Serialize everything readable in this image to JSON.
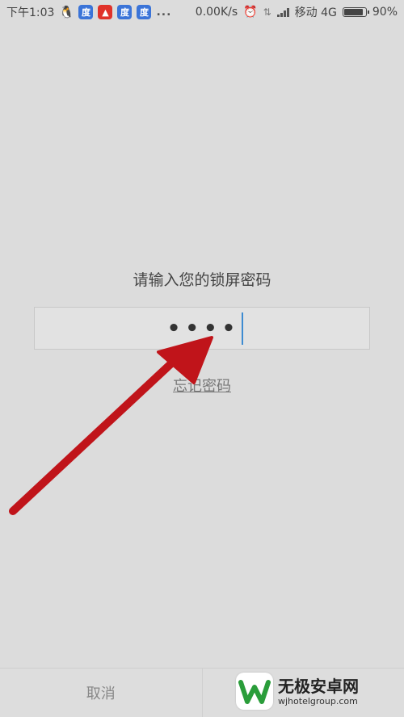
{
  "status_bar": {
    "time": "下午1:03",
    "network_speed": "0.00K/s",
    "carrier": "移动 4G",
    "battery_percent": "90%",
    "battery_level": 0.9,
    "more_indicator": "...",
    "icons": [
      "qq-icon",
      "baidu-icon",
      "red-app-icon",
      "baidu-icon",
      "baidu-icon",
      "alarm-icon",
      "data-arrows-icon",
      "signal-icon",
      "battery-icon"
    ]
  },
  "lock": {
    "prompt": "请输入您的锁屏密码",
    "password_mask": "••••",
    "forgot_link": "忘记密码"
  },
  "bottom": {
    "cancel_label": "取消"
  },
  "watermark": {
    "title": "无极安卓网",
    "url": "wjhotelgroup.com"
  },
  "colors": {
    "background": "#dcdcdc",
    "caret": "#3d8bd1",
    "arrow": "#c0141a"
  }
}
